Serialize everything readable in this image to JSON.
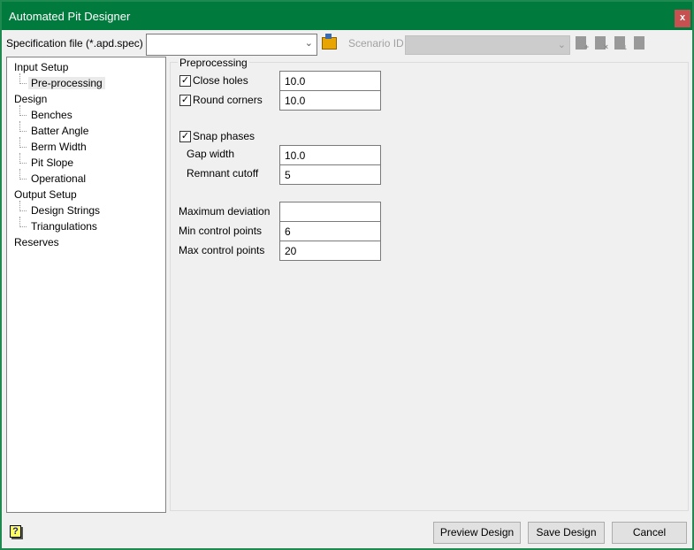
{
  "window": {
    "title": "Automated Pit Designer",
    "close_label": "x"
  },
  "spec": {
    "label": "Specification file (*.apd.spec)",
    "value": "",
    "scenario_label": "Scenario ID",
    "scenario_value": ""
  },
  "toolbar_icons": [
    "new-scenario-icon",
    "delete-scenario-icon",
    "save-scenario-icon",
    "document-icon"
  ],
  "tree": [
    {
      "label": "Input Setup",
      "level": 0
    },
    {
      "label": "Pre-processing",
      "level": 1,
      "selected": true
    },
    {
      "label": "Design",
      "level": 0
    },
    {
      "label": "Benches",
      "level": 1
    },
    {
      "label": "Batter Angle",
      "level": 1
    },
    {
      "label": "Berm Width",
      "level": 1
    },
    {
      "label": "Pit Slope",
      "level": 1
    },
    {
      "label": "Operational",
      "level": 1
    },
    {
      "label": "Output Setup",
      "level": 0
    },
    {
      "label": "Design Strings",
      "level": 1
    },
    {
      "label": "Triangulations",
      "level": 1
    },
    {
      "label": "Reserves",
      "level": 0
    }
  ],
  "group": {
    "title": "Preprocessing",
    "close_holes": {
      "label": "Close holes",
      "checked": true,
      "value": "10.0"
    },
    "round_corners": {
      "label": "Round corners",
      "checked": true,
      "value": "10.0"
    },
    "snap_phases": {
      "label": "Snap phases",
      "checked": true
    },
    "gap_width": {
      "label": "Gap width",
      "value": "10.0"
    },
    "remnant_cutoff": {
      "label": "Remnant cutoff",
      "value": "5"
    },
    "max_deviation": {
      "label": "Maximum deviation",
      "value": ""
    },
    "min_control": {
      "label": "Min control points",
      "value": "6"
    },
    "max_control": {
      "label": "Max control points",
      "value": "20"
    }
  },
  "buttons": {
    "preview": "Preview Design",
    "save": "Save Design",
    "cancel": "Cancel"
  },
  "colors": {
    "title_bar": "#007a3d",
    "close": "#c75050"
  }
}
